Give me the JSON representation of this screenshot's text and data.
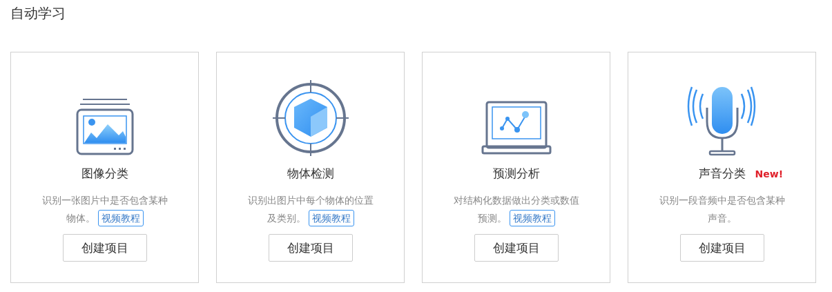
{
  "section_title": "自动学习",
  "cards": [
    {
      "kind": "image",
      "title": "图像分类",
      "description": "识别一张图片中是否包含某种物体。",
      "tutorial_link": "视频教程",
      "button": "创建项目"
    },
    {
      "kind": "target",
      "title": "物体检测",
      "description": "识别出图片中每个物体的位置及类别。",
      "tutorial_link": "视频教程",
      "button": "创建项目"
    },
    {
      "kind": "chart",
      "title": "预测分析",
      "description": "对结构化数据做出分类或数值预测。",
      "tutorial_link": "视频教程",
      "button": "创建项目"
    },
    {
      "kind": "mic",
      "title": "声音分类",
      "badge": "New!",
      "description": "识别一段音频中是否包含某种声音。",
      "button": "创建项目"
    }
  ]
}
